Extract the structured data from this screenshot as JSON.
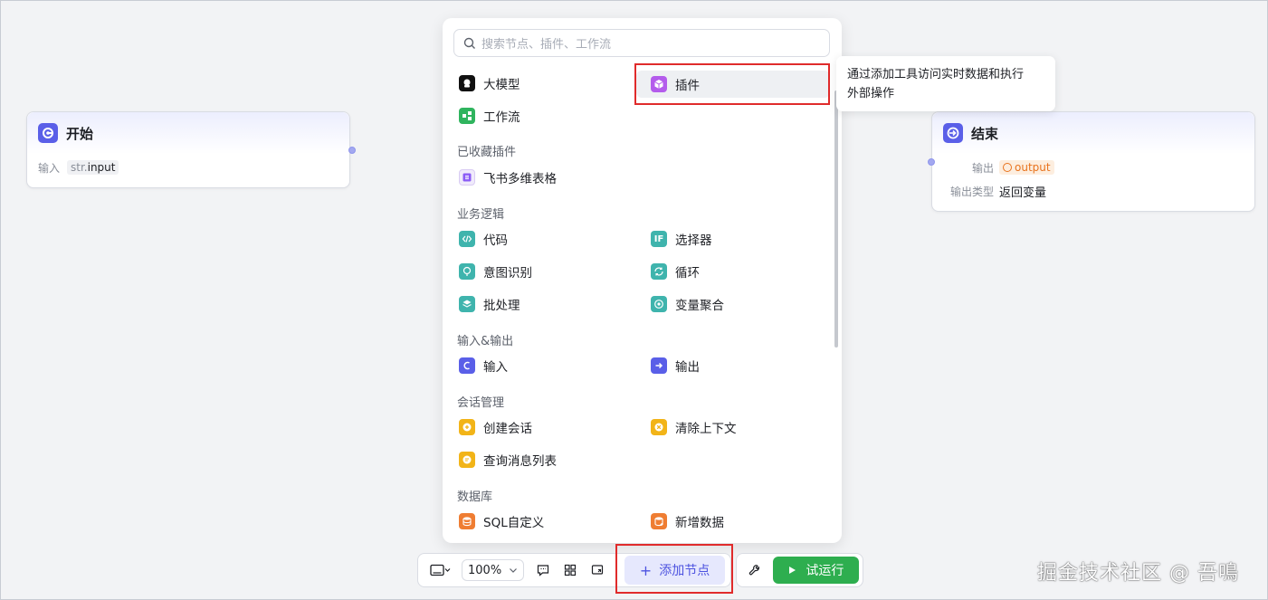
{
  "start_node": {
    "title": "开始",
    "input_label": "输入",
    "input_type": "str.",
    "input_name": "input"
  },
  "end_node": {
    "title": "结束",
    "output_label": "输出",
    "output_var": "output",
    "output_type_label": "输出类型",
    "output_type_value": "返回变量"
  },
  "search": {
    "placeholder": "搜索节点、插件、工作流"
  },
  "top_items": [
    {
      "label": "大模型",
      "icon": "llm-icon"
    },
    {
      "label": "插件",
      "icon": "plugin-icon"
    },
    {
      "label": "工作流",
      "icon": "workflow-icon"
    }
  ],
  "categories": [
    {
      "title": "已收藏插件",
      "items": [
        {
          "label": "飞书多维表格",
          "icon": "spreadsheet-icon"
        }
      ]
    },
    {
      "title": "业务逻辑",
      "items": [
        {
          "label": "代码",
          "icon": "code-icon"
        },
        {
          "label": "选择器",
          "icon": "if-icon"
        },
        {
          "label": "意图识别",
          "icon": "intent-icon"
        },
        {
          "label": "循环",
          "icon": "loop-icon"
        },
        {
          "label": "批处理",
          "icon": "batch-icon"
        },
        {
          "label": "变量聚合",
          "icon": "aggregate-icon"
        }
      ]
    },
    {
      "title": "输入&输出",
      "items": [
        {
          "label": "输入",
          "icon": "input-icon"
        },
        {
          "label": "输出",
          "icon": "output-icon"
        }
      ]
    },
    {
      "title": "会话管理",
      "items": [
        {
          "label": "创建会话",
          "icon": "create-chat-icon"
        },
        {
          "label": "清除上下文",
          "icon": "clear-context-icon"
        },
        {
          "label": "查询消息列表",
          "icon": "message-list-icon"
        }
      ]
    },
    {
      "title": "数据库",
      "items": [
        {
          "label": "SQL自定义",
          "icon": "sql-icon"
        },
        {
          "label": "新增数据",
          "icon": "add-data-icon"
        }
      ]
    }
  ],
  "tooltip": {
    "line1": "通过添加工具访问实时数据和执行",
    "line2": "外部操作"
  },
  "toolbar": {
    "zoom": "100%",
    "add_node": "添加节点",
    "test_run": "试运行"
  },
  "watermark": "掘金技术社区 @ 吾鳴",
  "colors": {
    "accent": "#5a5fe8",
    "run_green": "#2eae4f",
    "highlight_red": "#e02b2b"
  }
}
